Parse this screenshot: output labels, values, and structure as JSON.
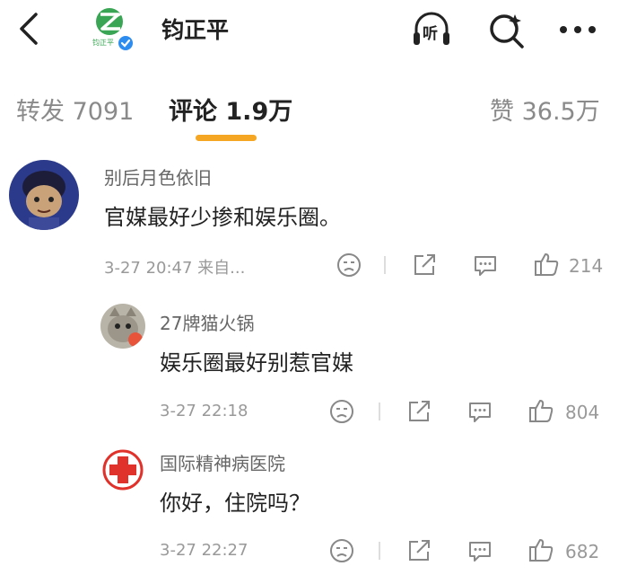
{
  "header": {
    "account_name": "钧正平",
    "logo_text": "钧正平",
    "icons": [
      "back-icon",
      "listen-icon",
      "search-icon",
      "more-icon"
    ],
    "listen_label": "听"
  },
  "tabs": [
    {
      "label": "转发 7091"
    },
    {
      "label": "评论 1.9万"
    },
    {
      "label": "赞 36.5万"
    }
  ],
  "accent_color": "#f5a623",
  "comments": [
    {
      "username": "别后月色依旧",
      "text": "官媒最好少掺和娱乐圈。",
      "meta": "3-27 20:47  来自...",
      "likes": "214"
    },
    {
      "username": "27牌猫火锅",
      "text": "娱乐圈最好别惹官媒",
      "meta": "3-27 22:18",
      "likes": "804"
    },
    {
      "username": "国际精神病医院",
      "text": "你好，住院吗？",
      "meta": "3-27 22:27",
      "likes": "682"
    }
  ]
}
